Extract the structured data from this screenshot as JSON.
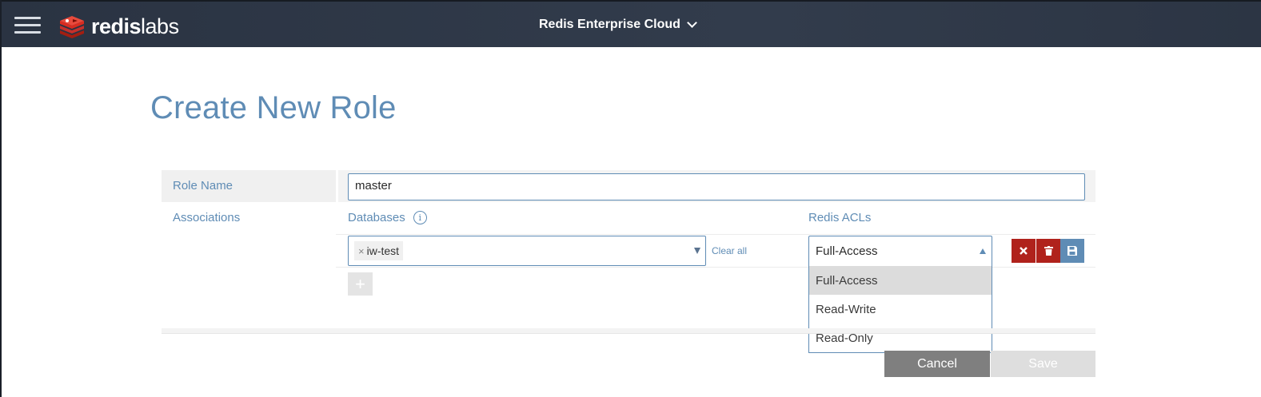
{
  "header": {
    "brand_bold": "redis",
    "brand_light": "labs",
    "environment": "Redis Enterprise Cloud",
    "menu_icon": "hamburger-icon",
    "logo_icon": "redis-stack-logo-icon",
    "env_icon": "chevron-down-icon"
  },
  "page": {
    "title": "Create New Role"
  },
  "form": {
    "role_name_label": "Role Name",
    "role_name_value": "master",
    "associations_label": "Associations",
    "databases_label": "Databases",
    "info_glyph": "i",
    "redis_acls_label": "Redis ACLs",
    "selected_database": "iw-test",
    "chip_remove": "×",
    "clear_all": "Clear all",
    "acl_selected": "Full-Access",
    "acl_options": [
      "Full-Access",
      "Read-Write",
      "Read-Only"
    ],
    "add_glyph": "+"
  },
  "actions": {
    "cancel": "Cancel",
    "save": "Save"
  },
  "colors": {
    "header_bg": "#2d3748",
    "accent": "#5f8cb5",
    "danger": "#b0221c",
    "cancel_bg": "#7f7f7f",
    "save_disabled_bg": "#dedede"
  }
}
